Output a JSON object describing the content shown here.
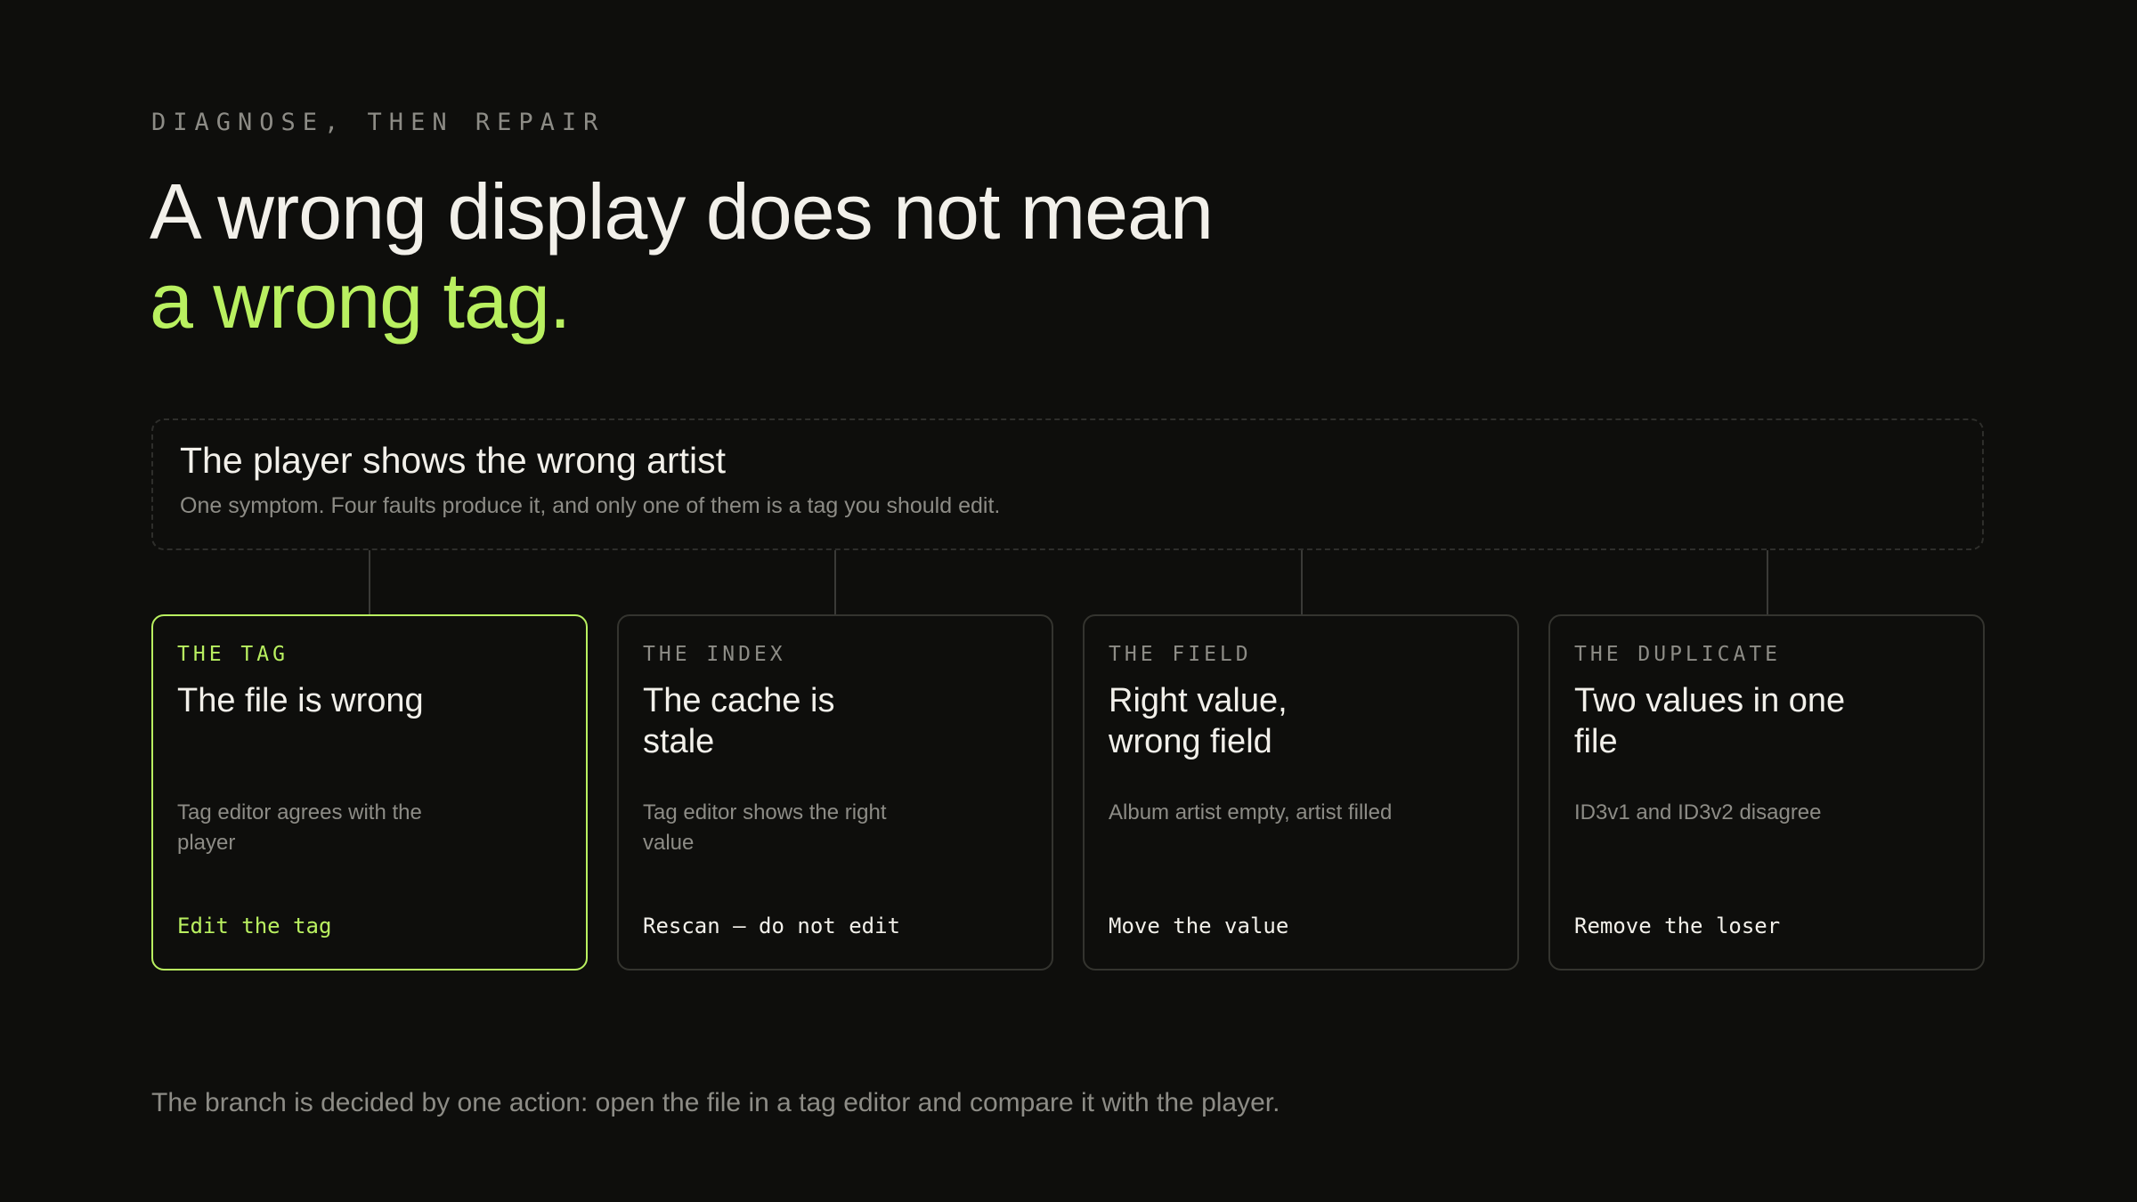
{
  "eyebrow": "DIAGNOSE, THEN REPAIR",
  "headline": {
    "line1": "A wrong display does not mean",
    "line2": "a wrong tag."
  },
  "symptom": {
    "title": "The player shows the wrong artist",
    "subtitle": "One symptom. Four faults produce it, and only one of them is a tag you should edit."
  },
  "cards": [
    {
      "kicker": "THE TAG",
      "title": "The file is wrong",
      "description": "Tag editor agrees with the player",
      "action": "Edit the tag",
      "highlighted": true
    },
    {
      "kicker": "THE INDEX",
      "title": "The cache is stale",
      "description": "Tag editor shows the right value",
      "action": "Rescan — do not edit",
      "highlighted": false
    },
    {
      "kicker": "THE FIELD",
      "title": "Right value, wrong field",
      "description": "Album artist empty, artist filled",
      "action": "Move the value",
      "highlighted": false
    },
    {
      "kicker": "THE DUPLICATE",
      "title": "Two values in one file",
      "description": "ID3v1 and ID3v2 disagree",
      "action": "Remove the loser",
      "highlighted": false
    }
  ],
  "footer_note": "The branch is decided by one action: open the file in a tag editor and compare it with the player.",
  "colors": {
    "background": "#0e0e0c",
    "accent": "#b9f060",
    "text": "#f2f0ea",
    "muted": "#8d8c86",
    "border": "#34342f"
  }
}
